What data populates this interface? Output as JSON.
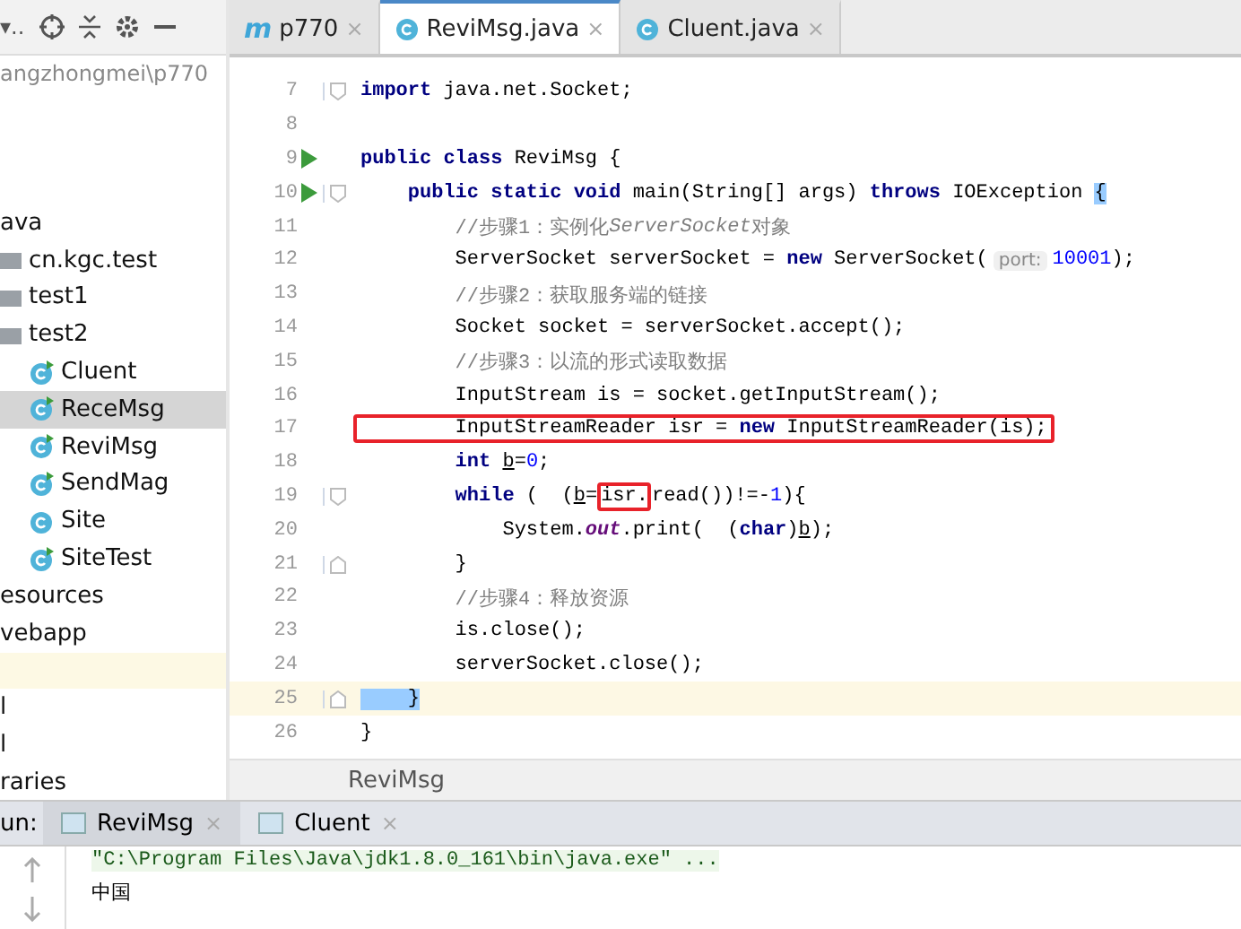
{
  "project_panel": {
    "toolbar_overflow": "▾..",
    "path": "angzhongmei\\p770",
    "tree": [
      {
        "label": "ava",
        "kind": "none",
        "selected": false,
        "children": [
          {
            "label": "cn.kgc.test",
            "kind": "package",
            "selected": false
          },
          {
            "label": "test1",
            "kind": "package",
            "selected": false
          },
          {
            "label": "test2",
            "kind": "package",
            "selected": false,
            "children": [
              {
                "label": "Cluent",
                "kind": "class-run",
                "selected": false
              },
              {
                "label": "ReceMsg",
                "kind": "class-run",
                "selected": true
              },
              {
                "label": "ReviMsg",
                "kind": "class-run",
                "selected": false
              },
              {
                "label": "SendMag",
                "kind": "class-run",
                "selected": false
              },
              {
                "label": "Site",
                "kind": "class",
                "selected": false
              },
              {
                "label": "SiteTest",
                "kind": "class-run",
                "selected": false
              }
            ]
          }
        ]
      },
      {
        "label": "esources",
        "kind": "none",
        "selected": false
      },
      {
        "label": "vebapp",
        "kind": "none",
        "selected": false
      },
      {
        "kind": "blank",
        "selected": false
      },
      {
        "label": "l",
        "kind": "none",
        "selected": false
      },
      {
        "label": "l",
        "kind": "none",
        "selected": false
      },
      {
        "label": "raries",
        "kind": "none",
        "selected": false
      }
    ]
  },
  "editor_tabs": [
    {
      "kind": "module",
      "icon": "m",
      "label": "p770",
      "close": "×",
      "selected": false
    },
    {
      "kind": "class",
      "label": "ReviMsg.java",
      "close": "×",
      "selected": true
    },
    {
      "kind": "class",
      "label": "Cluent.java",
      "close": "×",
      "selected": false
    }
  ],
  "code_lines": [
    {
      "number": "7",
      "run": false,
      "fold_start": true,
      "fold_end": false,
      "current": false,
      "boxed": false,
      "tokens": [
        {
          "kind": "keyword",
          "text": "import"
        },
        {
          "kind": "plain",
          "text": " java.net.Socket;"
        }
      ]
    },
    {
      "number": "8",
      "run": false,
      "fold_start": false,
      "fold_end": false,
      "current": false,
      "boxed": false
    },
    {
      "number": "9",
      "run": true,
      "fold_start": false,
      "fold_end": false,
      "current": false,
      "boxed": false,
      "tokens": [
        {
          "kind": "keyword",
          "text": "public class"
        },
        {
          "kind": "plain",
          "text": " ReviMsg {"
        }
      ]
    },
    {
      "number": "10",
      "run": true,
      "fold_start": true,
      "fold_end": false,
      "current": false,
      "boxed": false,
      "tokens": [
        {
          "kind": "keyword",
          "text": "    public static void"
        },
        {
          "kind": "plain",
          "text": " main(String[] args) "
        },
        {
          "kind": "keyword",
          "text": "throws"
        },
        {
          "kind": "plain",
          "text": " IOException "
        },
        {
          "kind": "brace",
          "text": "{"
        }
      ]
    },
    {
      "number": "11",
      "run": false,
      "fold_start": false,
      "fold_end": false,
      "current": false,
      "boxed": false,
      "tokens": [
        {
          "kind": "comment",
          "text": "        //步骤1：实例化"
        },
        {
          "kind": "comment-italic",
          "text": "ServerSocket"
        },
        {
          "kind": "comment",
          "text": "对象"
        }
      ]
    },
    {
      "number": "12",
      "run": false,
      "fold_start": false,
      "fold_end": false,
      "current": false,
      "boxed": false,
      "tokens": [
        {
          "kind": "plain",
          "text": "        ServerSocket serverSocket = "
        },
        {
          "kind": "keyword",
          "text": "new"
        },
        {
          "kind": "plain",
          "text": " ServerSocket("
        },
        {
          "kind": "hint",
          "text": "port:"
        },
        {
          "kind": "number",
          "text": "10001"
        },
        {
          "kind": "plain",
          "text": ");"
        }
      ]
    },
    {
      "number": "13",
      "run": false,
      "fold_start": false,
      "fold_end": false,
      "current": false,
      "boxed": false,
      "tokens": [
        {
          "kind": "comment",
          "text": "        //步骤2：获取服务端的链接"
        }
      ]
    },
    {
      "number": "14",
      "run": false,
      "fold_start": false,
      "fold_end": false,
      "current": false,
      "boxed": false,
      "tokens": [
        {
          "kind": "plain",
          "text": "        Socket socket = serverSocket.accept();"
        }
      ]
    },
    {
      "number": "15",
      "run": false,
      "fold_start": false,
      "fold_end": false,
      "current": false,
      "boxed": false,
      "tokens": [
        {
          "kind": "comment",
          "text": "        //步骤3：以流的形式读取数据"
        }
      ]
    },
    {
      "number": "16",
      "run": false,
      "fold_start": false,
      "fold_end": false,
      "current": false,
      "boxed": false,
      "tokens": [
        {
          "kind": "plain",
          "text": "        InputStream is = socket.getInputStream();"
        }
      ]
    },
    {
      "number": "17",
      "run": false,
      "fold_start": false,
      "fold_end": false,
      "current": false,
      "boxed": true,
      "tokens": [
        {
          "kind": "plain",
          "text": "        InputStreamReader isr = "
        },
        {
          "kind": "keyword",
          "text": "new"
        },
        {
          "kind": "plain",
          "text": " InputStreamReader(is);"
        }
      ]
    },
    {
      "number": "18",
      "run": false,
      "fold_start": false,
      "fold_end": false,
      "current": false,
      "boxed": false,
      "tokens": [
        {
          "kind": "keyword",
          "text": "        int "
        },
        {
          "kind": "variable",
          "text": "b"
        },
        {
          "kind": "plain",
          "text": "="
        },
        {
          "kind": "number",
          "text": "0"
        },
        {
          "kind": "plain",
          "text": ";"
        }
      ]
    },
    {
      "number": "19",
      "run": false,
      "fold_start": true,
      "fold_end": false,
      "current": false,
      "boxed": false,
      "tokens": [
        {
          "kind": "keyword",
          "text": "        while"
        },
        {
          "kind": "plain",
          "text": " (  ("
        },
        {
          "kind": "variable",
          "text": "b"
        },
        {
          "kind": "plain",
          "text": "="
        },
        {
          "kind": "boxed",
          "text": "isr."
        },
        {
          "kind": "plain",
          "text": "read())!=-"
        },
        {
          "kind": "number",
          "text": "1"
        },
        {
          "kind": "plain",
          "text": "){"
        }
      ]
    },
    {
      "number": "20",
      "run": false,
      "fold_start": false,
      "fold_end": false,
      "current": false,
      "boxed": false,
      "tokens": [
        {
          "kind": "plain",
          "text": "            System."
        },
        {
          "kind": "static",
          "text": "out"
        },
        {
          "kind": "plain",
          "text": ".print(  ("
        },
        {
          "kind": "keyword",
          "text": "char"
        },
        {
          "kind": "plain",
          "text": ")"
        },
        {
          "kind": "variable",
          "text": "b"
        },
        {
          "kind": "plain",
          "text": ");"
        }
      ]
    },
    {
      "number": "21",
      "run": false,
      "fold_start": false,
      "fold_end": true,
      "current": false,
      "boxed": false,
      "tokens": [
        {
          "kind": "plain",
          "text": "        }"
        }
      ]
    },
    {
      "number": "22",
      "run": false,
      "fold_start": false,
      "fold_end": false,
      "current": false,
      "boxed": false,
      "tokens": [
        {
          "kind": "comment",
          "text": "        //步骤4：释放资源"
        }
      ]
    },
    {
      "number": "23",
      "run": false,
      "fold_start": false,
      "fold_end": false,
      "current": false,
      "boxed": false,
      "tokens": [
        {
          "kind": "plain",
          "text": "        is.close();"
        }
      ]
    },
    {
      "number": "24",
      "run": false,
      "fold_start": false,
      "fold_end": false,
      "current": false,
      "boxed": false,
      "tokens": [
        {
          "kind": "plain",
          "text": "        serverSocket.close();"
        }
      ]
    },
    {
      "number": "25",
      "run": false,
      "fold_start": false,
      "fold_end": true,
      "current": true,
      "boxed": false,
      "tokens": [
        {
          "kind": "brace",
          "text": "    }"
        }
      ]
    },
    {
      "number": "26",
      "run": false,
      "fold_start": false,
      "fold_end": false,
      "current": false,
      "boxed": false,
      "tokens": [
        {
          "kind": "plain",
          "text": "}"
        }
      ]
    }
  ],
  "breadcrumb": "ReviMsg",
  "run_panel": {
    "label": "un:",
    "tabs": [
      {
        "label": "ReviMsg",
        "close": "×",
        "selected": true
      },
      {
        "label": "Cluent",
        "close": "×",
        "selected": false
      }
    ],
    "output": [
      {
        "kind": "command",
        "text": "\"C:\\Program Files\\Java\\jdk1.8.0_161\\bin\\java.exe\" ..."
      },
      {
        "kind": "plain",
        "text": "中国"
      }
    ]
  }
}
